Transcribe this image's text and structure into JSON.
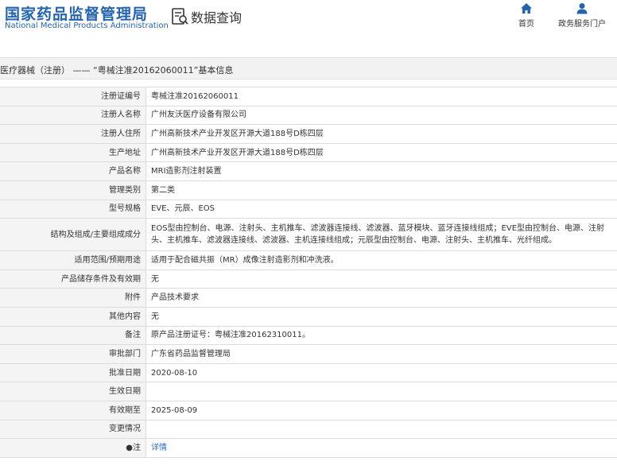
{
  "header": {
    "logo_cn": "国家药品监督管理局",
    "logo_en": "National Medical Products Administration",
    "query_title": "数据查询",
    "nav": {
      "home": "首页",
      "service": "政务服务门户"
    }
  },
  "breadcrumb": "医疗器械（注册） —— “粤械注准20162060011”基本信息",
  "rows": [
    {
      "label": "注册证编号",
      "value": "粤械注准20162060011"
    },
    {
      "label": "注册人名称",
      "value": "广州友沃医疗设备有限公司"
    },
    {
      "label": "注册人住所",
      "value": "广州高新技术产业开发区开源大道188号D栋四层"
    },
    {
      "label": "生产地址",
      "value": "广州高新技术产业开发区开源大道188号D栋四层"
    },
    {
      "label": "产品名称",
      "value": "MRI造影剂注射装置"
    },
    {
      "label": "管理类别",
      "value": "第二类"
    },
    {
      "label": "型号规格",
      "value": "EVE、元辰、EOS"
    },
    {
      "label": "结构及组成/主要组成成分",
      "value": "EOS型由控制台、电源、注射头、主机推车、滤波器连接线、滤波器、蓝牙模块、蓝牙连接线组成；EVE型由控制台、电源、注射头、主机推车、滤波器连接线、滤波器、主机连接线组成；元辰型由控制台、电源、注射头、主机推车、光纤组成。"
    },
    {
      "label": "适用范围/预期用途",
      "value": "适用于配合磁共振（MR）成像注射造影剂和冲洗液。"
    },
    {
      "label": "产品储存条件及有效期",
      "value": "无"
    },
    {
      "label": "附件",
      "value": "产品技术要求"
    },
    {
      "label": "其他内容",
      "value": "无"
    },
    {
      "label": "备注",
      "value": "原产品注册证号：粤械注准20162310011。"
    },
    {
      "label": "审批部门",
      "value": "广东省药品监督管理局"
    },
    {
      "label": "批准日期",
      "value": "2020-08-10"
    },
    {
      "label": "生效日期",
      "value": ""
    },
    {
      "label": "有效期至",
      "value": "2025-08-09"
    },
    {
      "label": "变更情况",
      "value": ""
    }
  ],
  "note": {
    "label": "●注",
    "link": "详情"
  },
  "colors": {
    "brand_blue": "#2364b0",
    "link_blue": "#2b6cc4",
    "label_bg": "#f4f4f4"
  }
}
